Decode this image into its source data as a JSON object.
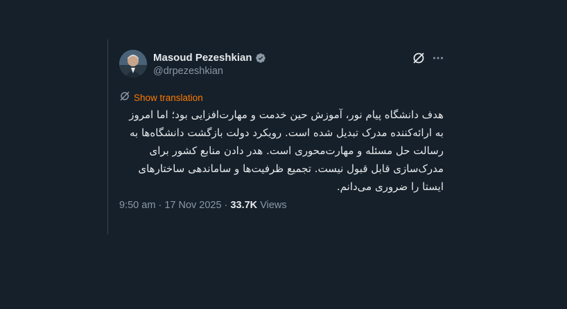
{
  "tweet": {
    "author_name": "Masoud Pezeshkian",
    "handle": "@drpezeshkian",
    "show_translation_label": "Show translation",
    "text": "هدف دانشگاه پیام نور، آموزش حین خدمت و مهارت‌افزایی بود؛ اما امروز به ارائه‌کننده مدرک تبدیل شده است. رویکرد دولت بازگشت دانشگاه‌ها به رسالت حل مسئله و مهارت‌محوری است. هدر دادن منابع کشور برای مدرک‌سازی قابل قبول نیست. تجمیع ظرفیت‌ها و ساماندهی ساختارهای ایستا را ضروری می‌دانم.",
    "time": "9:50 am",
    "separator": "·",
    "date": "17 Nov 2025",
    "views_count": "33.7K",
    "views_label": "Views"
  },
  "colors": {
    "background": "#15202b",
    "text": "#e7e9ea",
    "secondary": "#8b98a5",
    "verified": "#8b98a5",
    "translate": "#ff7a00"
  },
  "icons": {
    "verified": "verified-badge-icon",
    "grok": "grok-icon",
    "more": "more-icon",
    "translate": "translate-icon"
  }
}
